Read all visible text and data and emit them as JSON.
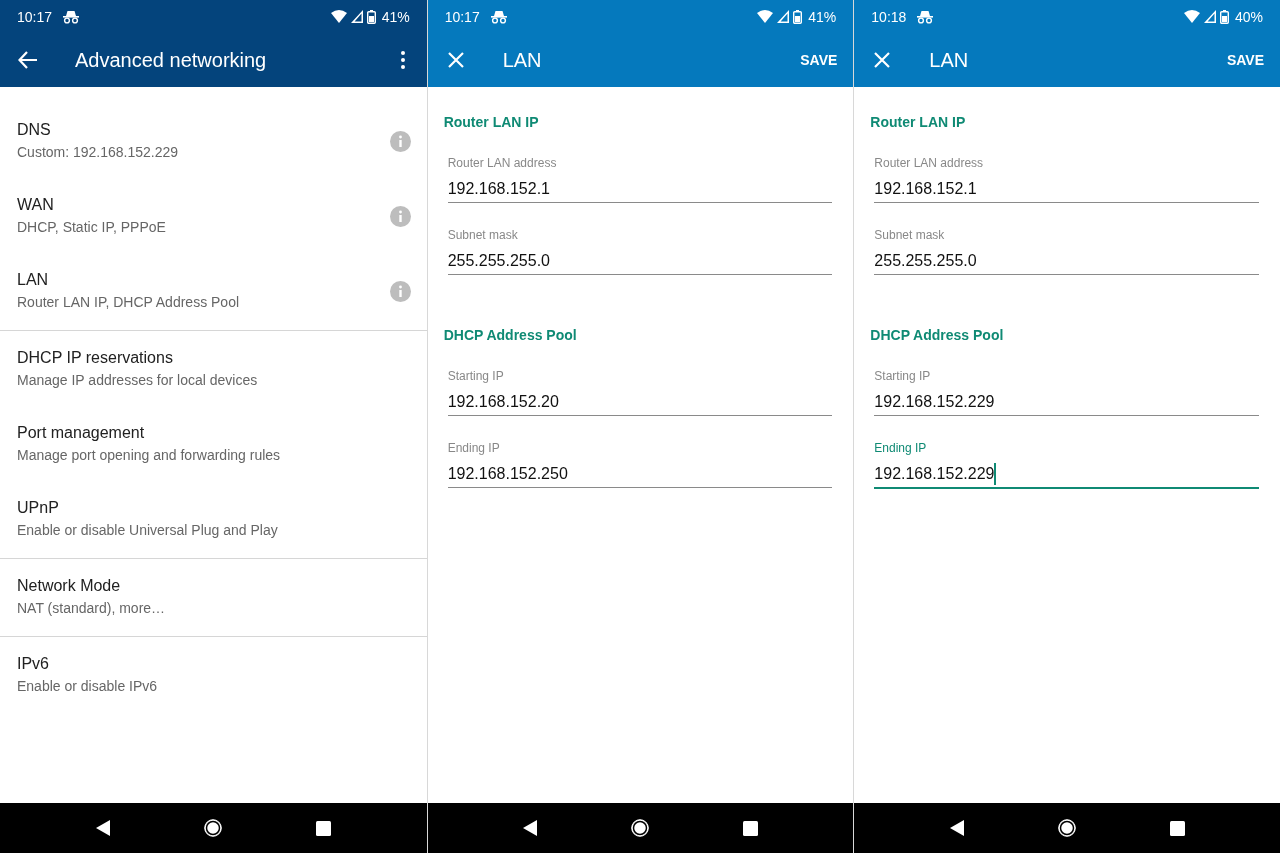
{
  "screens": [
    {
      "kind": "menu",
      "status_bar": {
        "time": "10:17",
        "battery": "41%"
      },
      "app_bar": {
        "nav": {
          "kind": "back"
        },
        "title": "Advanced networking",
        "action": {
          "kind": "overflow"
        }
      },
      "groups": [
        {
          "items": [
            {
              "title": "DNS",
              "subtitle": "Custom: 192.168.152.229",
              "info": true
            },
            {
              "title": "WAN",
              "subtitle": "DHCP, Static IP, PPPoE",
              "info": true
            },
            {
              "title": "LAN",
              "subtitle": "Router LAN IP, DHCP Address Pool",
              "info": true
            }
          ]
        },
        {
          "items": [
            {
              "title": "DHCP IP reservations",
              "subtitle": "Manage IP addresses for local devices",
              "info": false
            },
            {
              "title": "Port management",
              "subtitle": "Manage port opening and forwarding rules",
              "info": false
            },
            {
              "title": "UPnP",
              "subtitle": "Enable or disable Universal Plug and Play",
              "info": false
            }
          ]
        },
        {
          "items": [
            {
              "title": "Network Mode",
              "subtitle": "NAT (standard), more…",
              "info": false
            }
          ]
        },
        {
          "items": [
            {
              "title": "IPv6",
              "subtitle": "Enable or disable IPv6",
              "info": false
            }
          ]
        }
      ]
    },
    {
      "kind": "form",
      "status_bar": {
        "time": "10:17",
        "battery": "41%"
      },
      "app_bar": {
        "nav": {
          "kind": "close"
        },
        "title": "LAN",
        "action": {
          "kind": "text",
          "label": "SAVE"
        }
      },
      "sections": [
        {
          "title": "Router LAN IP",
          "fields": [
            {
              "label": "Router LAN address",
              "value": "192.168.152.1",
              "focused": false
            },
            {
              "label": "Subnet mask",
              "value": "255.255.255.0",
              "focused": false
            }
          ]
        },
        {
          "title": "DHCP Address Pool",
          "fields": [
            {
              "label": "Starting IP",
              "value": "192.168.152.20",
              "focused": false
            },
            {
              "label": "Ending IP",
              "value": "192.168.152.250",
              "focused": false
            }
          ]
        }
      ]
    },
    {
      "kind": "form",
      "status_bar": {
        "time": "10:18",
        "battery": "40%"
      },
      "app_bar": {
        "nav": {
          "kind": "close"
        },
        "title": "LAN",
        "action": {
          "kind": "text",
          "label": "SAVE"
        }
      },
      "sections": [
        {
          "title": "Router LAN IP",
          "fields": [
            {
              "label": "Router LAN address",
              "value": "192.168.152.1",
              "focused": false
            },
            {
              "label": "Subnet mask",
              "value": "255.255.255.0",
              "focused": false
            }
          ]
        },
        {
          "title": "DHCP Address Pool",
          "fields": [
            {
              "label": "Starting IP",
              "value": "192.168.152.229",
              "focused": false
            },
            {
              "label": "Ending IP",
              "value": "192.168.152.229",
              "focused": true
            }
          ]
        }
      ]
    }
  ]
}
